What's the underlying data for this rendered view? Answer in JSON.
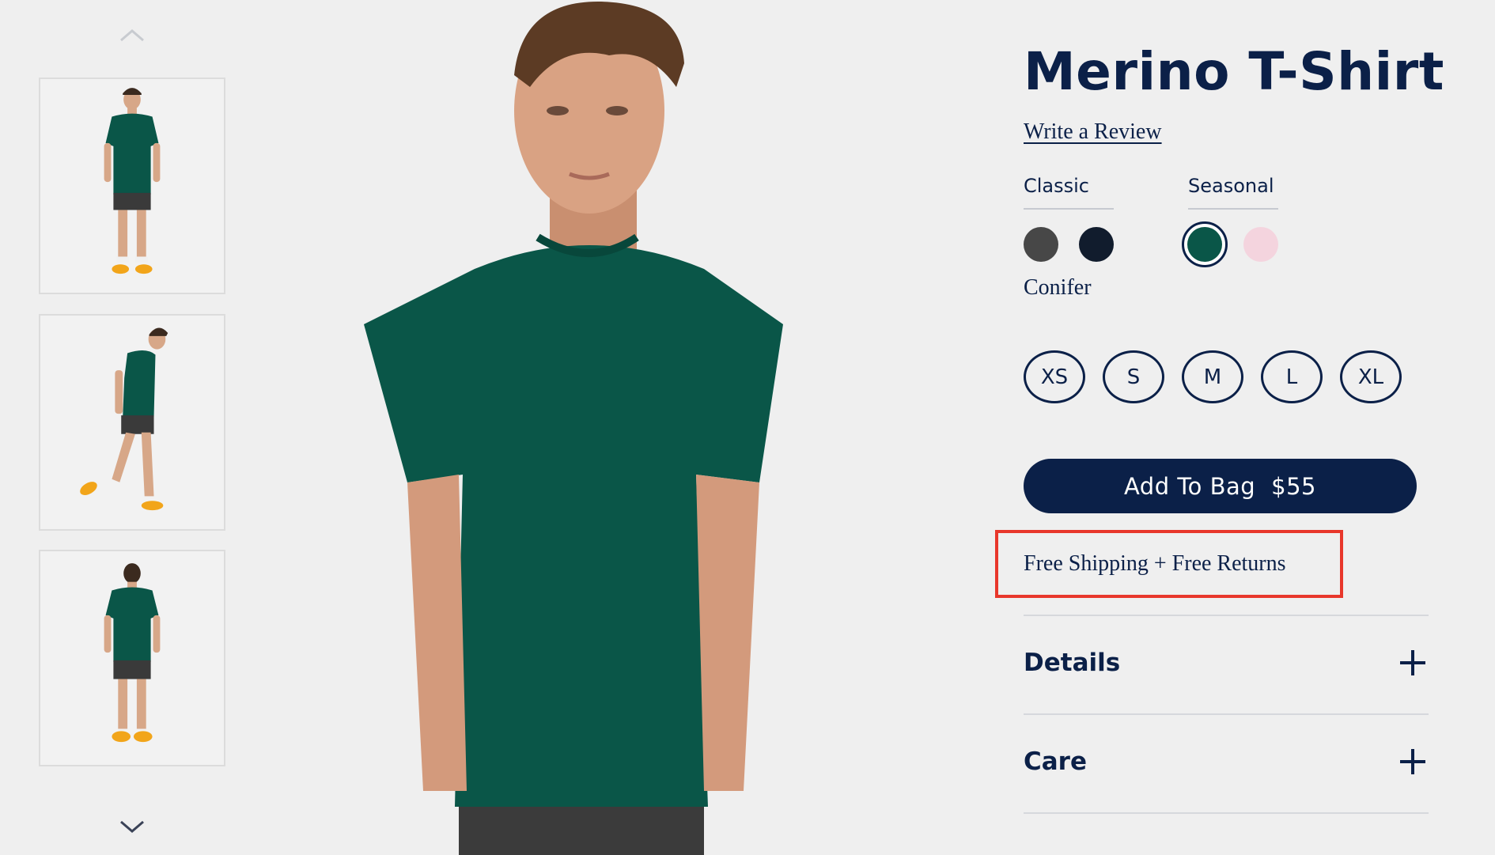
{
  "product": {
    "title": "Merino T-Shirt",
    "review_link": "Write a Review",
    "color_groups": {
      "classic_label": "Classic",
      "seasonal_label": "Seasonal"
    },
    "swatches": [
      {
        "name": "charcoal",
        "color": "#474747",
        "group": "Classic"
      },
      {
        "name": "navy",
        "color": "#111c2d",
        "group": "Classic"
      },
      {
        "name": "Conifer",
        "color": "#0a5648",
        "group": "Seasonal",
        "selected": true
      },
      {
        "name": "pink",
        "color": "#f4d4de",
        "group": "Seasonal"
      }
    ],
    "selected_color": "Conifer",
    "sizes": [
      "XS",
      "S",
      "M",
      "L",
      "XL"
    ],
    "add_to_bag": {
      "label": "Add To Bag",
      "price": "$55"
    },
    "shipping": "Free Shipping + Free Returns",
    "accordions": [
      "Details",
      "Care"
    ]
  },
  "gallery": {
    "thumbnails": [
      "front-view",
      "walking-side-view",
      "back-view"
    ],
    "up_arrow_icon": "chevron-up-icon",
    "down_arrow_icon": "chevron-down-icon"
  },
  "colors": {
    "brand_navy": "#0b2048",
    "shirt_green": "#0a5648",
    "highlight_red": "#e8372b",
    "background": "#efefef"
  }
}
